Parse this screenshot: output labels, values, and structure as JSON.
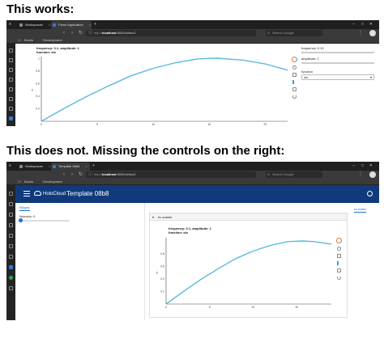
{
  "headings": {
    "works": "This works:",
    "not_works": "This does not. Missing the controls on the right:"
  },
  "shot1": {
    "tabs": [
      {
        "label": "Workspaces",
        "close": "×"
      },
      {
        "label": "Panel Application",
        "close": "×"
      }
    ],
    "new_tab": "+",
    "url": {
      "scheme": "http://",
      "host": "localhost",
      "path": ":5006/sinfoo2"
    },
    "search_placeholder": "Search Google",
    "bookmarks": [
      "Books",
      "Development"
    ],
    "plot": {
      "title_line1": "frequency: 0.1, amplitude: 1",
      "title_line2": "function: sin",
      "ylabel": "y",
      "xticks": [
        "0",
        "5",
        "10",
        "15",
        "20"
      ],
      "yticks": [
        "0.2",
        "0.4",
        "0.6",
        "0.8",
        "1"
      ]
    },
    "controls": {
      "frequency_label": "frequency: 0.10",
      "amplitude_label": "amplitude: 1",
      "function_label": "function",
      "function_value": "sin"
    }
  },
  "shot2": {
    "tabs": [
      {
        "label": "Workspaces",
        "close": "×"
      },
      {
        "label": "Template 08b8",
        "close": "×"
      }
    ],
    "new_tab": "+",
    "url": {
      "scheme": "http://",
      "host": "localhost",
      "path": ":5006/sinfoo2"
    },
    "search_placeholder": "Search Google",
    "bookmarks": [
      "Books",
      "Development"
    ],
    "header": {
      "logo_text": "HoloCloud",
      "title": "Template 08b8"
    },
    "sidebar": {
      "tab_label": "Widgets",
      "slider_label": "Numeric: 0"
    },
    "card": {
      "title": "hv scatter"
    },
    "right_tab": "hv scatter",
    "plot": {
      "title_line1": "frequency: 0.1, amplitude: 1",
      "title_line2": "function: sin",
      "ylabel": "y",
      "xticks": [
        "0",
        "5",
        "10",
        "15"
      ],
      "yticks": [
        "0.2",
        "0.4",
        "0.6",
        "0.8"
      ]
    }
  },
  "chart_data": [
    {
      "type": "line",
      "title": "frequency: 0.1, amplitude: 1\nfunction: sin",
      "xlabel": "",
      "ylabel": "y",
      "xlim": [
        0,
        22
      ],
      "ylim": [
        0,
        1
      ],
      "x": [
        0,
        2,
        4,
        6,
        8,
        10,
        12,
        14,
        15.7,
        18,
        20,
        22
      ],
      "values": [
        0,
        0.2,
        0.39,
        0.56,
        0.72,
        0.84,
        0.93,
        0.99,
        1.0,
        0.97,
        0.91,
        0.81
      ],
      "color": "#5bb8e0"
    },
    {
      "type": "line",
      "title": "frequency: 0.1, amplitude: 1\nfunction: sin",
      "xlabel": "",
      "ylabel": "y",
      "xlim": [
        0,
        19
      ],
      "ylim": [
        0,
        1
      ],
      "x": [
        0,
        2,
        4,
        6,
        8,
        10,
        12,
        14,
        15.7,
        17,
        19
      ],
      "values": [
        0,
        0.2,
        0.39,
        0.56,
        0.72,
        0.84,
        0.93,
        0.99,
        1.0,
        0.99,
        0.95
      ],
      "color": "#5bb8e0"
    }
  ],
  "colors": {
    "header_bg": "#113a7c",
    "accent": "#1f6ed4",
    "line": "#5bb8e0",
    "chrome_dark": "#1f1f1f"
  }
}
